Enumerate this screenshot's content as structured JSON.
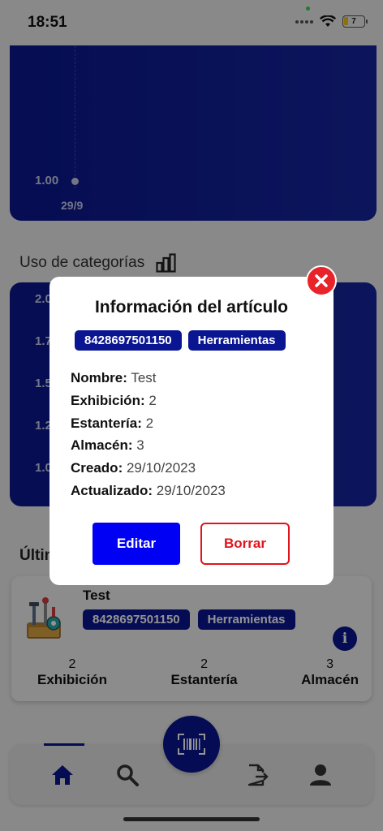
{
  "status_bar": {
    "time": "18:51",
    "battery": "7"
  },
  "chart_top": {
    "y_tick": "1.00",
    "x_tick": "29/9"
  },
  "categories_section": {
    "title": "Uso de categorías",
    "y_ticks": [
      "2.0",
      "1.7",
      "1.5",
      "1.2",
      "1.0"
    ]
  },
  "last_items": {
    "title": "Últim",
    "item": {
      "name": "Test",
      "code": "8428697501150",
      "category": "Herramientas",
      "stats": [
        {
          "value": "2",
          "label": "Exhibición"
        },
        {
          "value": "2",
          "label": "Estantería"
        },
        {
          "value": "3",
          "label": "Almacén"
        }
      ]
    }
  },
  "modal": {
    "title": "Información del artículo",
    "code": "8428697501150",
    "category": "Herramientas",
    "fields": [
      {
        "label": "Nombre:",
        "value": "Test"
      },
      {
        "label": "Exhibición:",
        "value": "2"
      },
      {
        "label": "Estantería:",
        "value": "2"
      },
      {
        "label": "Almacén:",
        "value": "3"
      },
      {
        "label": "Creado:",
        "value": "29/10/2023"
      },
      {
        "label": "Actualizado:",
        "value": "29/10/2023"
      }
    ],
    "edit_label": "Editar",
    "delete_label": "Borrar"
  },
  "colors": {
    "primary": "#0a1592",
    "accent_blue": "#0000f5",
    "danger": "#e0141c"
  },
  "nav": {
    "icons": [
      "home-icon",
      "search-icon",
      "barcode-scan-icon",
      "file-export-icon",
      "user-icon"
    ]
  }
}
